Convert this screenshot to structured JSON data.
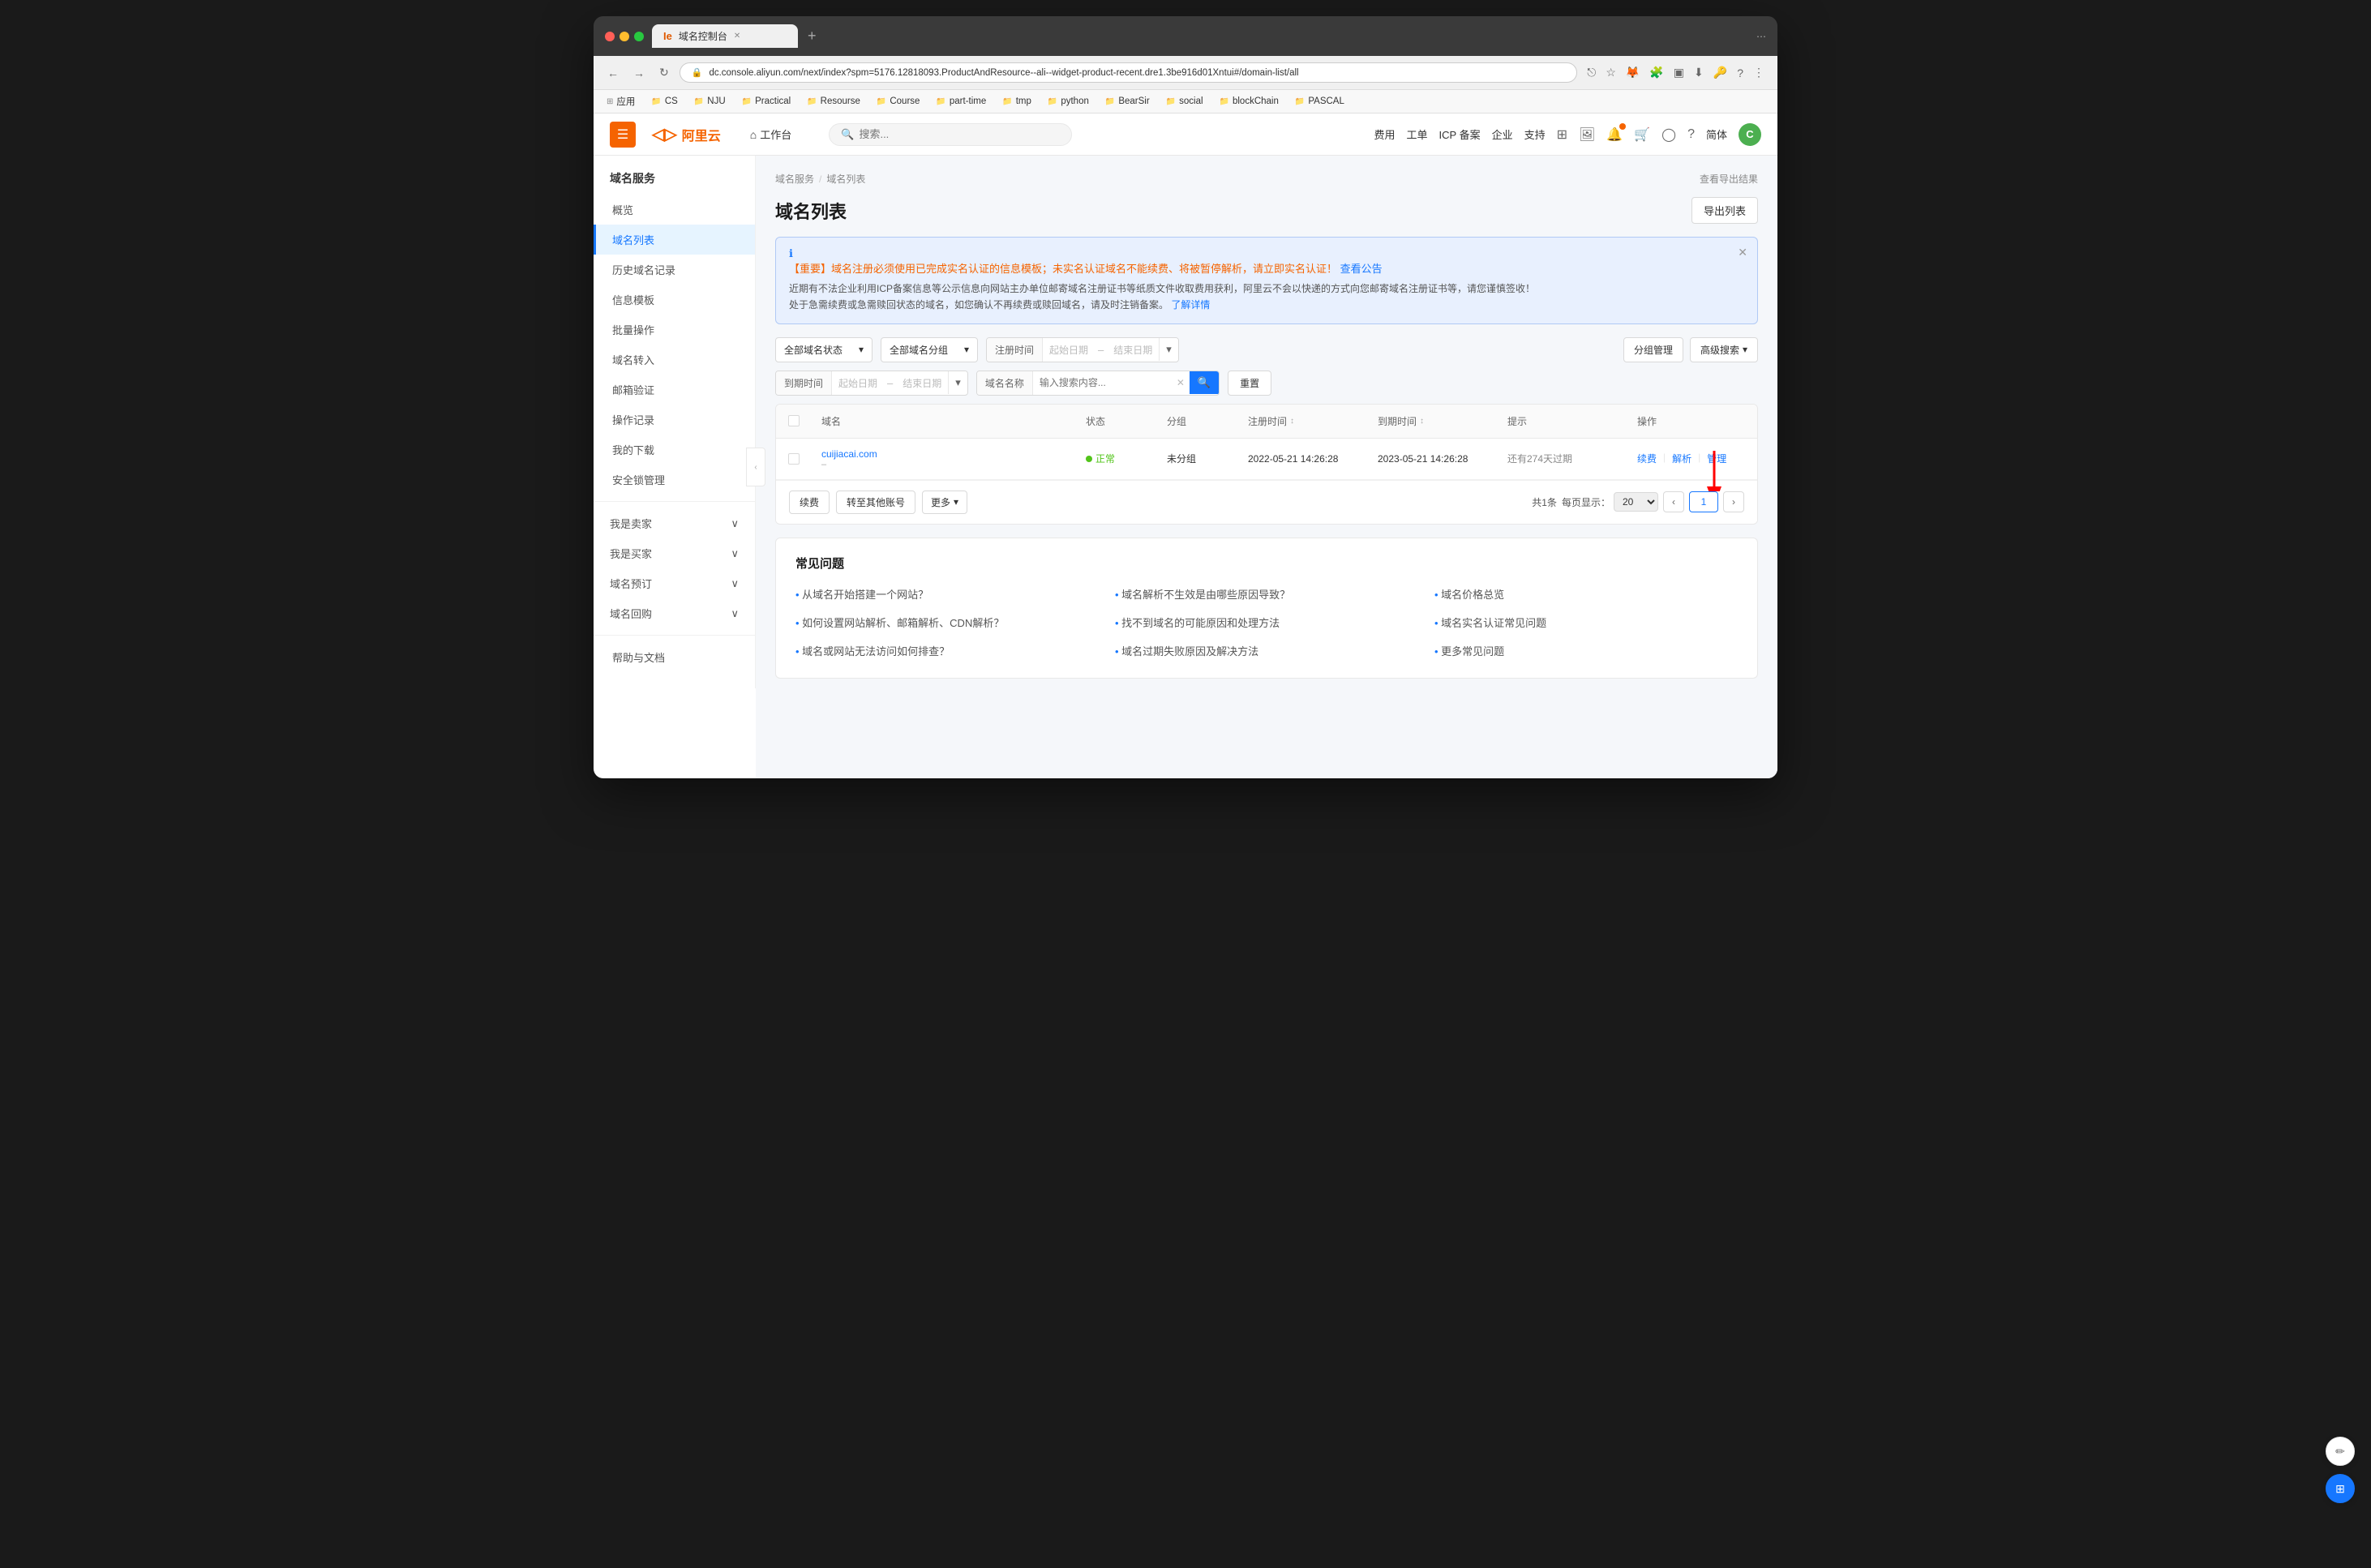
{
  "browser": {
    "tab_label": "域名控制台",
    "tab_icon": "Ie",
    "url": "dc.console.aliyun.com/next/index?spm=5176.12818093.ProductAndResource--ali--widget-product-recent.dre1.3be916d01Xntui#/domain-list/all",
    "bookmarks": [
      {
        "label": "应用"
      },
      {
        "label": "CS"
      },
      {
        "label": "NJU"
      },
      {
        "label": "Practical"
      },
      {
        "label": "Resourse"
      },
      {
        "label": "Course"
      },
      {
        "label": "part-time"
      },
      {
        "label": "tmp"
      },
      {
        "label": "python"
      },
      {
        "label": "BearSir"
      },
      {
        "label": "social"
      },
      {
        "label": "blockChain"
      },
      {
        "label": "PASCAL"
      }
    ]
  },
  "header": {
    "logo_text": "阿里云",
    "nav_items": [
      {
        "label": "工作台",
        "icon": "🏠"
      }
    ],
    "search_placeholder": "搜索...",
    "right_items": [
      {
        "label": "费用"
      },
      {
        "label": "工单"
      },
      {
        "label": "ICP 备案"
      },
      {
        "label": "企业"
      },
      {
        "label": "支持"
      }
    ],
    "avatar_text": "C"
  },
  "sidebar": {
    "section_title": "域名服务",
    "items": [
      {
        "label": "概览",
        "active": false
      },
      {
        "label": "域名列表",
        "active": true
      },
      {
        "label": "历史域名记录",
        "active": false
      },
      {
        "label": "信息模板",
        "active": false
      },
      {
        "label": "批量操作",
        "active": false
      },
      {
        "label": "域名转入",
        "active": false
      },
      {
        "label": "邮箱验证",
        "active": false
      },
      {
        "label": "操作记录",
        "active": false
      },
      {
        "label": "我的下载",
        "active": false
      },
      {
        "label": "安全锁管理",
        "active": false
      }
    ],
    "groups": [
      {
        "label": "我是卖家"
      },
      {
        "label": "我是买家"
      },
      {
        "label": "域名预订"
      },
      {
        "label": "域名回购"
      }
    ],
    "bottom_items": [
      {
        "label": "帮助与文档"
      }
    ]
  },
  "breadcrumb": {
    "items": [
      {
        "label": "域名服务"
      },
      {
        "label": "域名列表"
      }
    ]
  },
  "page": {
    "title": "域名列表",
    "view_results_label": "查看导出结果",
    "export_btn": "导出列表"
  },
  "alert": {
    "title_part1": "【重要】域名注册必须使用已完成实名认证的信息模板；未实名认证域名不能续费、将被暂停解析，请立即实名认证！",
    "title_link": "查看公告",
    "body_line1": "近期有不法企业利用ICP备案信息等公示信息向网站主办单位邮寄域名注册证书等纸质文件收取费用获利，阿里云不会以快递的方式向您邮寄域名注册证书等，请您谨慎签收！",
    "body_line2": "处于急需续费或急需赎回状态的域名，如您确认不再续费或赎回域名，请及时注销备案。",
    "body_link": "了解详情"
  },
  "filters": {
    "status_options": [
      "全部域名状态"
    ],
    "group_options": [
      "全部域名分组"
    ],
    "register_time_label": "注册时间",
    "start_date_placeholder": "起始日期",
    "end_date_placeholder": "结束日期",
    "group_mgmt_label": "分组管理",
    "advanced_search_label": "高级搜索",
    "expire_time_label": "到期时间",
    "domain_name_label": "域名名称",
    "domain_search_placeholder": "输入搜索内容...",
    "reset_label": "重置"
  },
  "table": {
    "columns": [
      {
        "label": "域名"
      },
      {
        "label": "状态"
      },
      {
        "label": "分组"
      },
      {
        "label": "注册时间",
        "sortable": true
      },
      {
        "label": "到期时间",
        "sortable": true
      },
      {
        "label": "提示"
      },
      {
        "label": "操作"
      }
    ],
    "rows": [
      {
        "domain": "cuijiacai.com",
        "domain_sub": "–",
        "status": "正常",
        "group": "未分组",
        "register_time": "2022-05-21 14:26:28",
        "expire_time": "2023-05-21 14:26:28",
        "hint": "还有274天过期",
        "actions": [
          "续费",
          "解析",
          "管理"
        ]
      }
    ],
    "footer": {
      "continue_btn": "续费",
      "transfer_btn": "转至其他账号",
      "more_btn": "更多",
      "total_label": "共1条",
      "per_page_label": "每页显示：",
      "per_page_value": "20",
      "current_page": "1"
    }
  },
  "faq": {
    "title": "常见问题",
    "items": [
      {
        "label": "从域名开始搭建一个网站？"
      },
      {
        "label": "如何设置网站解析、邮箱解析、CDN解析？"
      },
      {
        "label": "域名或网站无法访问如何排查？"
      },
      {
        "label": "域名解析不生效是由哪些原因导致？"
      },
      {
        "label": "找不到域名的可能原因和处理方法"
      },
      {
        "label": "域名过期失败原因及解决方法"
      },
      {
        "label": "域名价格总览"
      },
      {
        "label": "域名实名认证常见问题"
      },
      {
        "label": "更多常见问题"
      }
    ]
  }
}
